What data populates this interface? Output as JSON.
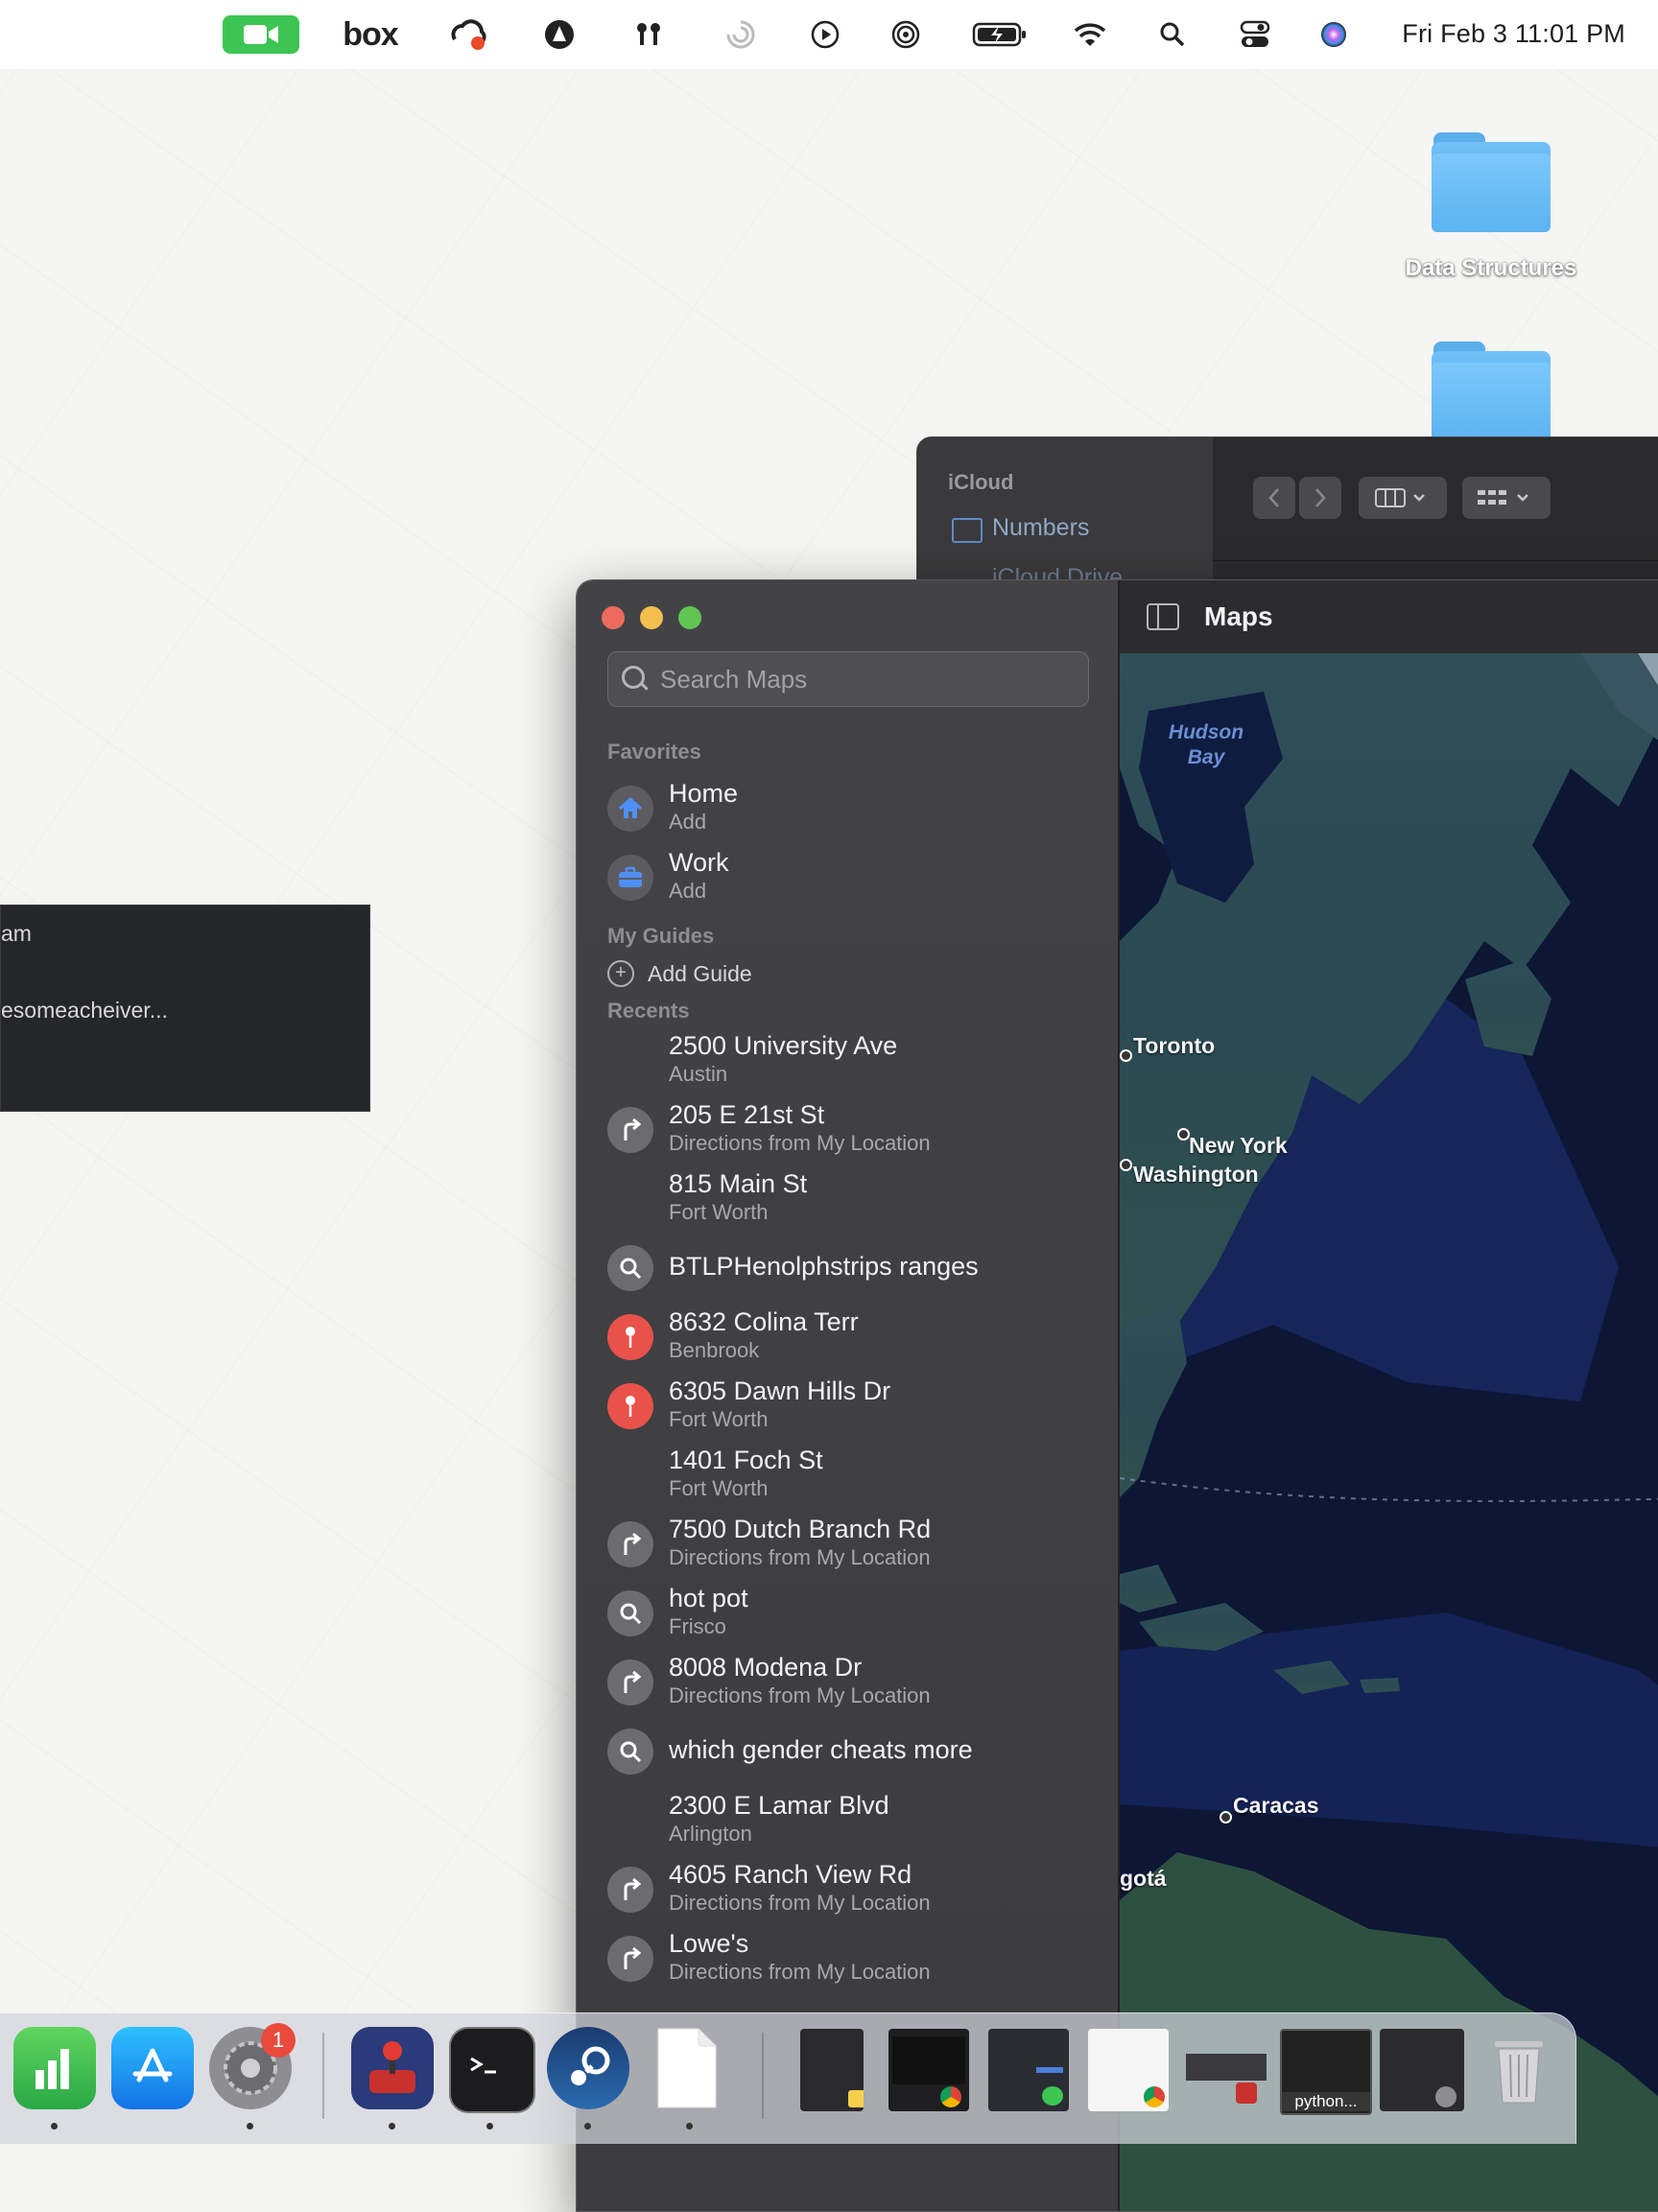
{
  "menubar": {
    "clock": "Fri Feb 3  11:01 PM",
    "icons": [
      "facetime-video-icon",
      "box-icon",
      "creative-cloud-icon",
      "avast-icon",
      "airpods-icon",
      "focus-icon",
      "play-icon",
      "airdrop-icon",
      "battery-icon",
      "wifi-icon",
      "spotlight-search-icon",
      "control-center-icon",
      "siri-icon"
    ],
    "box_label": "box"
  },
  "desktop": {
    "folders": [
      {
        "label": "Data Structures"
      },
      {
        "label": ""
      }
    ],
    "popup": {
      "line1": "am",
      "line2": "esomeacheiver..."
    }
  },
  "finder": {
    "sidebar_heading": "iCloud",
    "sidebar_item": "Numbers",
    "sidebar_item2": "iCloud Drive"
  },
  "maps": {
    "title": "Maps",
    "search_placeholder": "Search Maps",
    "favorites_heading": "Favorites",
    "favorites": [
      {
        "title": "Home",
        "subtitle": "Add",
        "icon": "house-icon"
      },
      {
        "title": "Work",
        "subtitle": "Add",
        "icon": "briefcase-icon"
      }
    ],
    "guides_heading": "My Guides",
    "add_guide": "Add Guide",
    "recents_heading": "Recents",
    "recents": [
      {
        "title": "2500 University Ave",
        "subtitle": "Austin",
        "icon": "none"
      },
      {
        "title": "205 E 21st St",
        "subtitle": "Directions from My Location",
        "icon": "directions-icon"
      },
      {
        "title": "815 Main St",
        "subtitle": "Fort Worth",
        "icon": "none"
      },
      {
        "title": "BTLPHenolphstrips ranges",
        "subtitle": "",
        "icon": "search-icon"
      },
      {
        "title": "8632 Colina Terr",
        "subtitle": "Benbrook",
        "icon": "pin-icon"
      },
      {
        "title": "6305 Dawn Hills Dr",
        "subtitle": "Fort Worth",
        "icon": "pin-icon"
      },
      {
        "title": "1401 Foch St",
        "subtitle": "Fort Worth",
        "icon": "none"
      },
      {
        "title": "7500 Dutch Branch Rd",
        "subtitle": "Directions from My Location",
        "icon": "directions-icon"
      },
      {
        "title": "hot pot",
        "subtitle": "Frisco",
        "icon": "search-icon"
      },
      {
        "title": "8008 Modena Dr",
        "subtitle": "Directions from My Location",
        "icon": "directions-icon"
      },
      {
        "title": "which gender cheats more",
        "subtitle": "",
        "icon": "search-icon"
      },
      {
        "title": "2300 E Lamar Blvd",
        "subtitle": "Arlington",
        "icon": "none"
      },
      {
        "title": "4605 Ranch View Rd",
        "subtitle": "Directions from My Location",
        "icon": "directions-icon"
      },
      {
        "title": "Lowe's",
        "subtitle": "Directions from My Location",
        "icon": "directions-icon"
      }
    ],
    "map_labels": {
      "hudson_bay": "Hudson\nBay",
      "toronto": "Toronto",
      "new_york": "New York",
      "washington": "Washington",
      "caracas": "Caracas",
      "bogota": "gotá"
    }
  },
  "dock": {
    "apps": [
      "numbers-icon",
      "app-store-icon",
      "system-settings-icon",
      "joystick-icon",
      "terminal-icon",
      "steam-icon",
      "blank-document-icon"
    ],
    "settings_badge": "1",
    "thumb_label": "python..."
  }
}
